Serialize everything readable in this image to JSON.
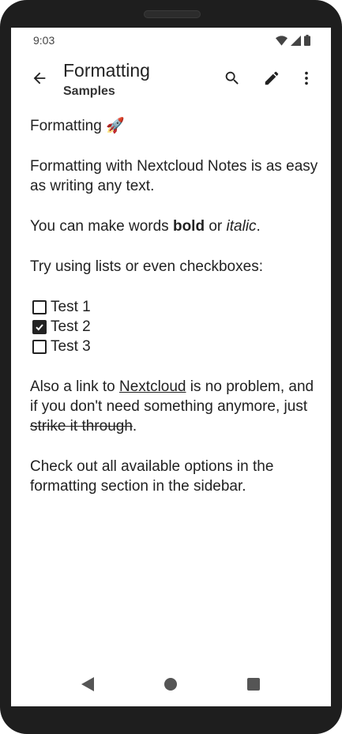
{
  "status": {
    "time": "9:03",
    "icons": [
      "wifi-icon",
      "signal-icon",
      "battery-icon"
    ]
  },
  "appbar": {
    "title": "Formatting",
    "subtitle": "Samples",
    "icons": [
      "back-arrow-icon",
      "search-icon",
      "edit-pencil-icon",
      "more-vert-icon"
    ]
  },
  "note": {
    "heading": "Formatting",
    "heading_emoji": "🚀",
    "para1": "Formatting with Nextcloud Notes is as easy as writing any text.",
    "para2_before": "You can make words ",
    "para2_bold": "bold",
    "para2_mid": " or ",
    "para2_italic": "italic",
    "para2_after": ".",
    "para3": "Try using lists or even checkboxes:",
    "checklist": [
      {
        "label": "Test 1",
        "checked": false
      },
      {
        "label": "Test 2",
        "checked": true
      },
      {
        "label": "Test 3",
        "checked": false
      }
    ],
    "para4_before": "Also a link to ",
    "para4_link": "Nextcloud",
    "para4_mid": " is no problem, and if you don't need something anymore, just ",
    "para4_strike": "strike it through",
    "para4_after": ".",
    "para5": "Check out all available options in the formatting section in the sidebar."
  },
  "navbar": {
    "icons": [
      "back-triangle-icon",
      "home-circle-icon",
      "recents-square-icon"
    ]
  },
  "colors": {
    "frame": "#1e1e1e",
    "text": "#222222",
    "background": "#ffffff"
  }
}
